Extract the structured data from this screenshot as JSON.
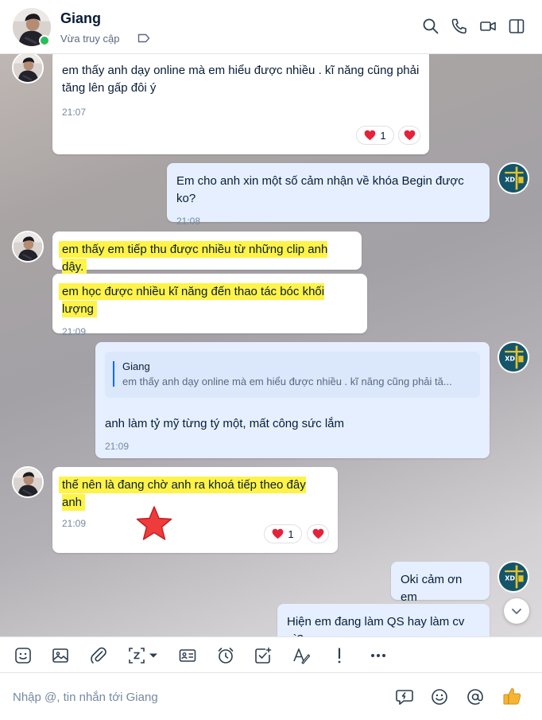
{
  "header": {
    "name": "Giang",
    "status": "Vừa truy cập",
    "online_color": "#2dbc5a",
    "icons": [
      "search-icon",
      "phone-icon",
      "video-icon",
      "sidebar-toggle-icon"
    ]
  },
  "messages": [
    {
      "from": "Giang",
      "text": "em thấy anh dạy online mà em hiểu được nhiều . kĩ năng cũng phải tăng lên gấp đôi ý",
      "time": "21:07",
      "reaction_count": "1"
    },
    {
      "from": "me",
      "text": "Em cho anh xin một số cảm nhận về khóa Begin được ko?",
      "time": "21:08"
    },
    {
      "from": "Giang",
      "text": "em thấy em tiếp thu được nhiều từ những clip anh dậy.",
      "highlighted": true
    },
    {
      "from": "Giang",
      "text": "em học được nhiều kĩ năng đến thao tác bóc khối lượng",
      "time": "21:09",
      "highlighted": true
    },
    {
      "from": "me",
      "quote_name": "Giang",
      "quote_text": "em thấy anh dạy online mà em hiểu được nhiều . kĩ năng cũng phải tă...",
      "text": "anh làm tỷ mỹ từng tý một, mất công sức lắm",
      "time": "21:09"
    },
    {
      "from": "Giang",
      "text": "thế nên là đang chờ anh ra khoá tiếp theo đây anh",
      "time": "21:09",
      "highlighted": true,
      "reaction_count": "1"
    },
    {
      "from": "me",
      "text": "Oki cảm ơn em"
    },
    {
      "from": "me",
      "text": "Hiện em đang làm QS hay làm cv gì?"
    }
  ],
  "my_avatar_text": "XD",
  "toolbar": {
    "icons": [
      "sticker-icon",
      "image-icon",
      "attachment-icon",
      "screenshot-icon",
      "business-card-icon",
      "reminder-icon",
      "task-icon",
      "text-format-icon",
      "important-icon",
      "more-icon"
    ]
  },
  "input": {
    "placeholder": "Nhập @, tin nhắn tới Giang"
  },
  "colors": {
    "highlight": "#fff347",
    "my_bubble": "#e5efff",
    "accent": "#0068ff",
    "heart": "#e5223a"
  }
}
